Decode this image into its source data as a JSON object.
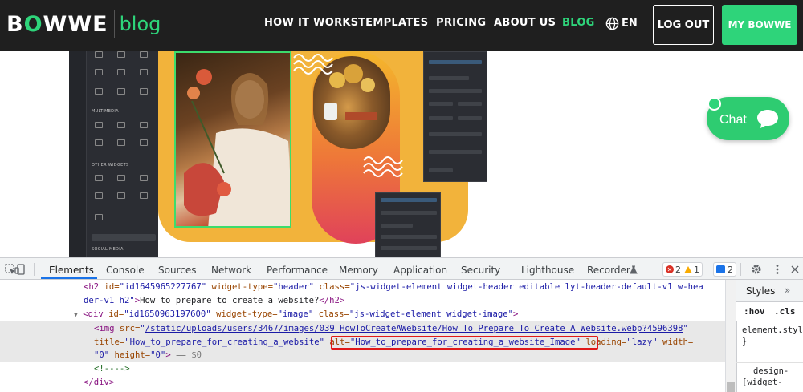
{
  "nav": {
    "logo_word_a": "B",
    "logo_word_o": "O",
    "logo_word_b": "WWE",
    "logo_blog": "blog",
    "items": [
      "HOW IT WORKS",
      "TEMPLATES",
      "PRICING",
      "ABOUT US",
      "BLOG"
    ],
    "lang": "EN",
    "logout": "LOG OUT",
    "my_bowwe": "MY BOWWE",
    "accent": "#2ed47a"
  },
  "editor": {
    "sections": [
      "MULTIMEDIA",
      "OTHER WIDGETS",
      "SOCIAL MEDIA"
    ]
  },
  "chat": {
    "label": "Chat"
  },
  "devtools": {
    "tabs": [
      "Elements",
      "Console",
      "Sources",
      "Network",
      "Performance",
      "Memory",
      "Application",
      "Security",
      "Lighthouse",
      "Recorder"
    ],
    "errors": "2",
    "warnings": "1",
    "messages": "2",
    "styles_tab": "Styles",
    "styles_more": "»",
    "filter_hov": ":hov",
    "filter_cls": ".cls",
    "element_style": "element.style {",
    "brace_close": "}",
    "rule1": "design-",
    "rule2": "[widget-",
    "code": {
      "l1_a": "<h2 ",
      "l1_attr1": "id=",
      "l1_val1": "\"id1645965227767\"",
      "l1_attr2": " widget-type=",
      "l1_val2": "\"header\"",
      "l1_attr3": " class=",
      "l1_val3": "\"js-widget-element widget-header editable lyt-header-default-v1 w-hea",
      "l2_val": "der-v1 h2\"",
      "l2_tag": ">",
      "l2_text": "How to prepare to create a website?",
      "l2_close": "</h2>",
      "l3_arrow": "▼",
      "l3_tag": "<div ",
      "l3_attr1": "id=",
      "l3_val1": "\"id1650963197600\"",
      "l3_attr2": " widget-type=",
      "l3_val2": "\"image\"",
      "l3_attr3": " class=",
      "l3_val3": "\"js-widget-element widget-image\"",
      "l3_end": ">",
      "l4_tag": "<img ",
      "l4_attr": "src=",
      "l4_q": "\"",
      "l4_link": "/static/uploads/users/3467/images/039_HowToCreateAWebsite/How_To_Prepare_To_Create_A_Website.webp?4596398",
      "l4_q2": "\"",
      "l5_attr1": "title=",
      "l5_val1": "\"How_to_prepare_for_creating_a_website\"",
      "l5_attr2": " alt=",
      "l5_val2": "\"How_to_prepare_for_creating_a_website_Image\"",
      "l5_attr3": " loading=",
      "l5_val3": "\"lazy\"",
      "l5_attr4": " width=",
      "l6_val1": "\"0\"",
      "l6_attr": " height=",
      "l6_val2": "\"0\"",
      "l6_end": ">",
      "l6_eq": " == $0",
      "l7_comment": "<!---->",
      "l8_close": "</div>"
    }
  }
}
